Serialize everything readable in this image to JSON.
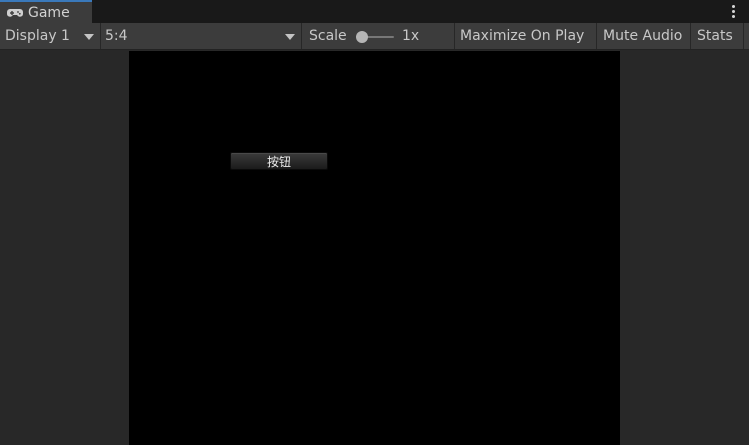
{
  "tab": {
    "label": "Game",
    "icon": "gamepad-icon",
    "accent": "#3a79bb"
  },
  "menu_icon": "kebab-menu-icon",
  "toolbar": {
    "display": "Display 1",
    "aspect": "5:4",
    "scale_label": "Scale",
    "scale_value": "1x",
    "scale_level": 0.0,
    "maximize": "Maximize On Play",
    "mute": "Mute Audio",
    "stats": "Stats"
  },
  "game": {
    "button_label": "按钮",
    "background": "#000000"
  }
}
